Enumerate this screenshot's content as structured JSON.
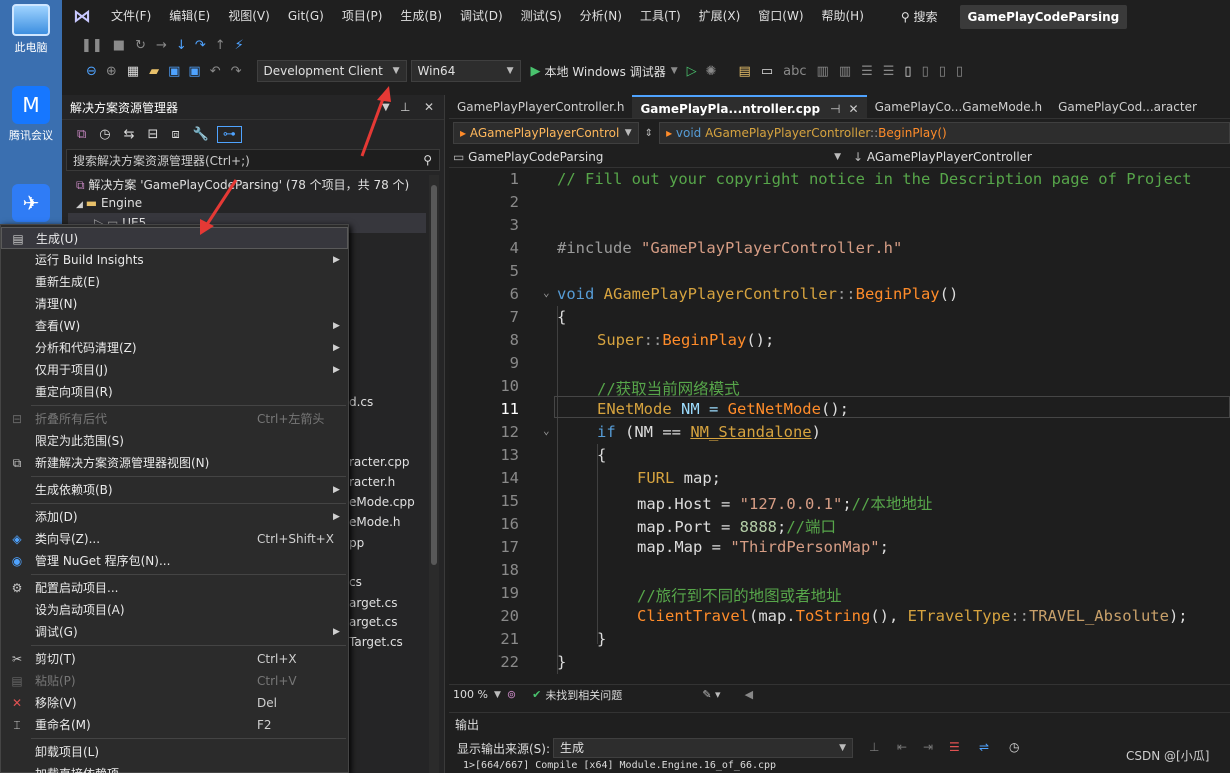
{
  "desktop": {
    "icons": [
      {
        "label": "此电脑"
      },
      {
        "label": "腾讯会议"
      }
    ]
  },
  "menubar": {
    "items": [
      "文件(F)",
      "编辑(E)",
      "视图(V)",
      "Git(G)",
      "项目(P)",
      "生成(B)",
      "调试(D)",
      "测试(S)",
      "分析(N)",
      "工具(T)",
      "扩展(X)",
      "窗口(W)",
      "帮助(H)"
    ],
    "search_label": "搜索",
    "solution_title": "GamePlayCodeParsing"
  },
  "toolbar": {
    "config": "Development Client",
    "platform": "Win64",
    "debugger_label": "本地 Windows 调试器"
  },
  "solution_explorer": {
    "title": "解决方案资源管理器",
    "search_placeholder": "搜索解决方案资源管理器(Ctrl+;)",
    "solution_row": "解决方案 'GamePlayCodeParsing' (78 个项目，共 78 个)",
    "engine_folder": "Engine",
    "ue5_item": "UE5",
    "file_fragments": [
      "d.cs",
      "racter.cpp",
      "racter.h",
      "eMode.cpp",
      "eMode.h",
      "pp",
      "cs",
      "arget.cs",
      "arget.cs",
      "Target.cs"
    ]
  },
  "context_menu": {
    "items": [
      {
        "label": "生成(U)",
        "icon": "build-icon"
      },
      {
        "label": "运行 Build Insights",
        "submenu": true
      },
      {
        "label": "重新生成(E)"
      },
      {
        "label": "清理(N)"
      },
      {
        "label": "查看(W)",
        "submenu": true
      },
      {
        "label": "分析和代码清理(Z)",
        "submenu": true
      },
      {
        "label": "仅用于项目(J)",
        "submenu": true
      },
      {
        "label": "重定向项目(R)"
      },
      {
        "label": "折叠所有后代",
        "shortcut": "Ctrl+左箭头",
        "disabled": true
      },
      {
        "label": "限定为此范围(S)"
      },
      {
        "label": "新建解决方案资源管理器视图(N)"
      },
      {
        "label": "生成依赖项(B)",
        "submenu": true
      },
      {
        "label": "添加(D)",
        "submenu": true
      },
      {
        "label": "类向导(Z)...",
        "shortcut": "Ctrl+Shift+X"
      },
      {
        "label": "管理 NuGet 程序包(N)..."
      },
      {
        "label": "配置启动项目..."
      },
      {
        "label": "设为启动项目(A)"
      },
      {
        "label": "调试(G)",
        "submenu": true
      },
      {
        "label": "剪切(T)",
        "shortcut": "Ctrl+X"
      },
      {
        "label": "粘贴(P)",
        "shortcut": "Ctrl+V",
        "disabled": true
      },
      {
        "label": "移除(V)",
        "shortcut": "Del"
      },
      {
        "label": "重命名(M)",
        "shortcut": "F2"
      },
      {
        "label": "卸载项目(L)"
      },
      {
        "label": "加载直接依赖项"
      }
    ]
  },
  "editor": {
    "tabs": [
      {
        "label": "GamePlayPlayerController.h"
      },
      {
        "label": "GamePlayPla...ntroller.cpp",
        "active": true
      },
      {
        "label": "GamePlayCo...GameMode.h"
      },
      {
        "label": "GamePlayCod...aracter"
      }
    ],
    "nav_class": "AGamePlayPlayerControl",
    "nav_kw": "void",
    "nav_member_class": "AGamePlayPlayerController",
    "nav_member_sep": "::",
    "nav_member_func": "BeginPlay()",
    "project_combo": "GamePlayCodeParsing",
    "scope_combo": "AGamePlayPlayerController",
    "line_numbers": [
      "1",
      "2",
      "3",
      "4",
      "5",
      "6",
      "7",
      "8",
      "9",
      "10",
      "11",
      "12",
      "13",
      "14",
      "15",
      "16",
      "17",
      "18",
      "19",
      "20",
      "21",
      "22"
    ],
    "code": {
      "l1": "// Fill out your copyright notice in the Description page of Project",
      "l4_kw": "#include",
      "l4_str": "\"GamePlayPlayerController.h\"",
      "l6_kw": "void",
      "l6_cls": "AGamePlayPlayerController",
      "l6_sep": "::",
      "l6_fn": "BeginPlay",
      "l6_end": "()",
      "l7": "{",
      "l8_cls": "Super",
      "l8_sep": "::",
      "l8_fn": "BeginPlay",
      "l8_end": "();",
      "l10": "//获取当前网络模式",
      "l11_ty": "ENetMode",
      "l11_mid": " NM = ",
      "l11_fn": "GetNetMode",
      "l11_end": "();",
      "l12_kw": "if",
      "l12_a": " (NM == ",
      "l12_en": "NM_Standalone",
      "l12_b": ")",
      "l13": "{",
      "l14_ty": "FURL",
      "l14_rest": " map;",
      "l15_a": "map.Host = ",
      "l15_str": "\"127.0.0.1\"",
      "l15_b": ";",
      "l15_cm": "//本地地址",
      "l16_a": "map.Port = ",
      "l16_num": "8888",
      "l16_b": ";",
      "l16_cm": "//端口",
      "l17_a": "map.Map = ",
      "l17_str": "\"ThirdPersonMap\"",
      "l17_b": ";",
      "l19": "//旅行到不同的地图或者地址",
      "l20_fn": "ClientTravel",
      "l20_a": "(map.",
      "l20_fn2": "ToString",
      "l20_b": "(), ",
      "l20_ty": "ETravelType",
      "l20_sep": "::",
      "l20_en": "TRAVEL_Absolute",
      "l20_c": ");",
      "l21": "}",
      "l22": "}"
    }
  },
  "status": {
    "zoom": "100 %",
    "issues": "未找到相关问题"
  },
  "output": {
    "title": "输出",
    "source_label": "显示输出来源(S):",
    "source_value": "生成",
    "line": "1>[664/667] Compile [x64] Module.Engine.16_of_66.cpp"
  },
  "watermark": "CSDN @[小瓜]",
  "colors": {
    "accent": "#4fa3ff",
    "comment": "#57a64a",
    "function": "#ff8c2a",
    "type": "#d6a33f",
    "arrow": "#e53935"
  }
}
